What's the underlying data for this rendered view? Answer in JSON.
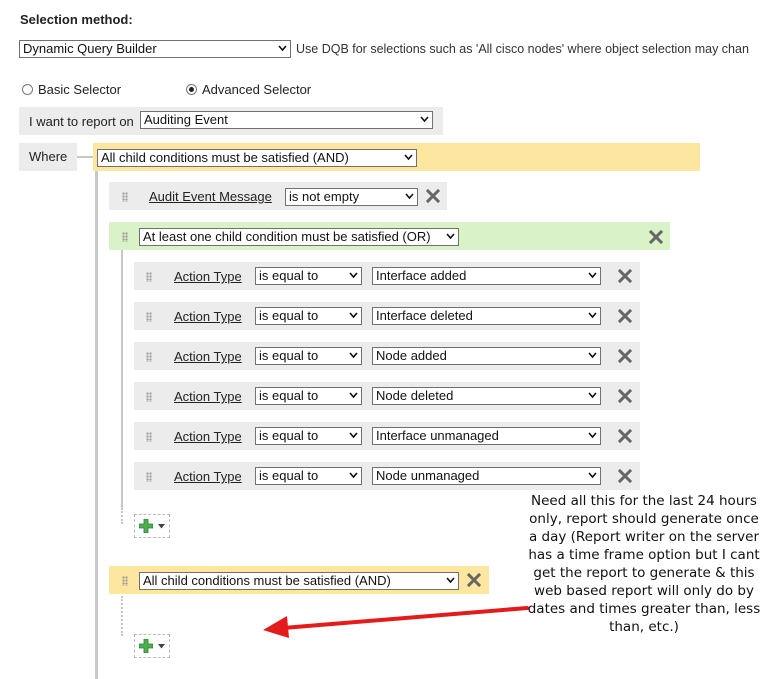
{
  "selection": {
    "heading": "Selection method:",
    "method_value": "Dynamic Query Builder",
    "method_hint": "Use DQB for selections such as 'All cisco nodes' where object selection may chan"
  },
  "selector_mode": {
    "basic_label": "Basic Selector",
    "advanced_label": "Advanced Selector",
    "selected": "Advanced Selector"
  },
  "report_on": {
    "label": "I want to report on",
    "value": "Auditing Event"
  },
  "where": {
    "label": "Where",
    "root_group": "All child conditions must be satisfied (AND)",
    "condition1": {
      "field": "Audit Event Message",
      "operator": "is not empty"
    },
    "or_group": {
      "label": "At least one child condition must be satisfied (OR)",
      "conditions": [
        {
          "field": "Action Type",
          "operator": "is equal to",
          "value": "Interface added"
        },
        {
          "field": "Action Type",
          "operator": "is equal to",
          "value": "Interface deleted"
        },
        {
          "field": "Action Type",
          "operator": "is equal to",
          "value": "Node added"
        },
        {
          "field": "Action Type",
          "operator": "is equal to",
          "value": "Node deleted"
        },
        {
          "field": "Action Type",
          "operator": "is equal to",
          "value": "Interface unmanaged"
        },
        {
          "field": "Action Type",
          "operator": "is equal to",
          "value": "Node unmanaged"
        }
      ]
    },
    "and_group": {
      "label": "All child conditions must be satisfied (AND)"
    }
  },
  "annotation": {
    "text": "Need all this for the last 24 hours only, report should generate once a day (Report writer on the server has a time frame option but I cant get the report to generate & this web based report will only do by dates and times greater than, less than, etc.)",
    "arrow_color": "#e31b1b"
  },
  "colors": {
    "and_group_bg": "#fde7a0",
    "or_group_bg": "#d9f2c8",
    "condition_bg": "#ececec",
    "remove_icon": "#666666",
    "add_icon": "#4caf50"
  }
}
